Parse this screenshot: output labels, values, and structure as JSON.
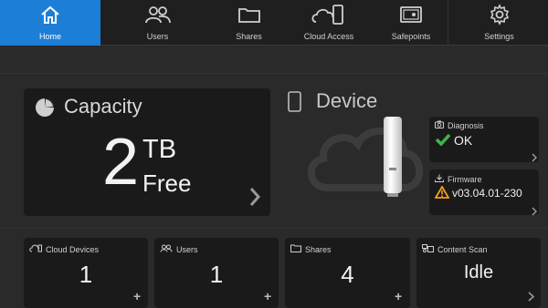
{
  "nav": {
    "items": [
      {
        "label": "Home",
        "icon": "home-icon"
      },
      {
        "label": "Users",
        "icon": "users-icon"
      },
      {
        "label": "Shares",
        "icon": "folder-icon"
      },
      {
        "label": "Cloud Access",
        "icon": "cloud-access-icon"
      },
      {
        "label": "Safepoints",
        "icon": "safe-icon"
      },
      {
        "label": "Settings",
        "icon": "gear-icon"
      }
    ],
    "active": "Home",
    "accent": "#1c7ed6"
  },
  "capacity": {
    "title": "Capacity",
    "value": "2",
    "unit": "TB",
    "status": "Free"
  },
  "device": {
    "title": "Device"
  },
  "diagnosis": {
    "label": "Diagnosis",
    "status": "OK",
    "status_color": "#3fb54a"
  },
  "firmware": {
    "label": "Firmware",
    "version": "v03.04.01-230",
    "warning_color": "#f0a020"
  },
  "tiles": {
    "cloud_devices": {
      "label": "Cloud Devices",
      "value": "1"
    },
    "users": {
      "label": "Users",
      "value": "1"
    },
    "shares": {
      "label": "Shares",
      "value": "4"
    },
    "content_scan": {
      "label": "Content Scan",
      "value": "Idle"
    }
  }
}
